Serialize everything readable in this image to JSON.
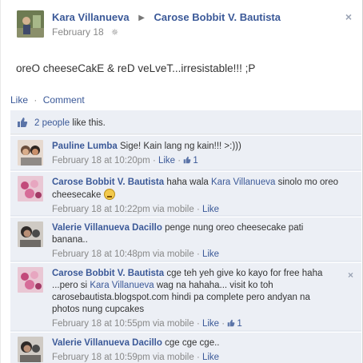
{
  "post": {
    "author": "Kara Villanueva",
    "target": "Carose Bobbit V. Bautista",
    "date": "February 18",
    "message": "oreO cheeseCakE & reD veLveT...irresistable!!! ;P",
    "close_glyph": "×"
  },
  "actions": {
    "like": "Like",
    "separator": "·",
    "comment": "Comment"
  },
  "likes": {
    "count_text": "2 people",
    "suffix": "like this."
  },
  "comments": [
    {
      "author": "Pauline Lumba",
      "text": "Sige! Kain lang ng kain!!! >:)))",
      "time": "February 18 at 10:20pm",
      "via": "",
      "like_label": "Like",
      "like_count": "1",
      "emoji": false,
      "avatar_colors": [
        "#6b4e3d",
        "#c98f6a"
      ]
    },
    {
      "author": "Carose Bobbit V. Bautista",
      "text_a": "haha wala",
      "mention": "Kara Villanueva",
      "text_b": "sinolo mo oreo cheesecake",
      "time": "February 18 at 10:22pm",
      "via": "via mobile",
      "like_label": "Like",
      "emoji": true,
      "avatar_colors": [
        "#c24a7a",
        "#e7a6c0"
      ]
    },
    {
      "author": "Valerie Villanueva Dacillo",
      "text": "penge nung oreo cheesecake pati banana..",
      "time": "February 18 at 10:48pm",
      "via": "via mobile",
      "like_label": "Like",
      "avatar_colors": [
        "#4a4a4a",
        "#9a8f86"
      ]
    },
    {
      "author": "Carose Bobbit V. Bautista",
      "text_a": "cge teh yeh give ko kayo for free haha ...pero si",
      "mention": "Kara Villanueva",
      "text_b": "wag na hahaha... visit ko toh carosebautista.blogspot.com hindi pa complete pero andyan na photos nung cupcakes",
      "time": "February 18 at 10:55pm",
      "via": "via mobile",
      "like_label": "Like",
      "like_count": "1",
      "close_glyph": "×",
      "avatar_colors": [
        "#c24a7a",
        "#e7a6c0"
      ]
    },
    {
      "author": "Valerie Villanueva Dacillo",
      "text": "cge cge cge..",
      "time": "February 18 at 10:59pm",
      "via": "via mobile",
      "like_label": "Like",
      "avatar_colors": [
        "#4a4a4a",
        "#9a8f86"
      ]
    }
  ],
  "colors": {
    "link": "#3b5998",
    "feedback_bg": "#eceff5",
    "meta": "#888888"
  },
  "icons": {
    "gear": "gear-icon",
    "thumb": "thumbs-up-icon",
    "close": "close-icon"
  }
}
